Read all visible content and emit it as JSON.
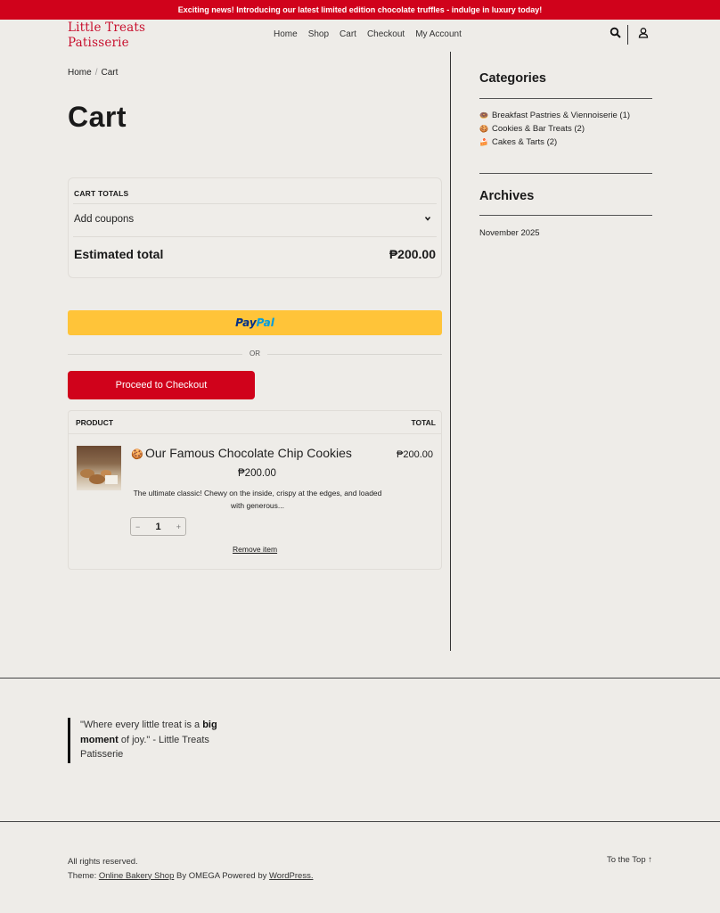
{
  "announcement": "Exciting news! Introducing our latest limited edition chocolate truffles - indulge in luxury today!",
  "brand": {
    "line1": "Little Treats",
    "line2": "Patisserie",
    "color": "#c8102e"
  },
  "nav": [
    "Home",
    "Shop",
    "Cart",
    "Checkout",
    "My Account"
  ],
  "header_icons": [
    "search-icon",
    "user-icon"
  ],
  "breadcrumb": {
    "home": "Home",
    "separator": "/",
    "current": "Cart"
  },
  "page_title": "Cart",
  "cart_totals": {
    "heading": "CART TOTALS",
    "coupon_label": "Add coupons",
    "estimated_label": "Estimated total",
    "estimated_value": "₱200.00"
  },
  "paypal": {
    "part1": "Pay",
    "part2": "Pal",
    "bg": "#ffc439"
  },
  "or_text": "OR",
  "checkout_button": "Proceed to Checkout",
  "items_table": {
    "col_product": "PRODUCT",
    "col_total": "TOTAL",
    "items": [
      {
        "icon": "🍪",
        "name": "Our Famous Chocolate Chip Cookies",
        "price": "₱200.00",
        "description": "The ultimate classic! Chewy on the inside, crispy at the edges, and loaded with generous...",
        "quantity": "1",
        "minus": "−",
        "plus": "+",
        "remove_label": "Remove item",
        "line_total": "₱200.00"
      }
    ]
  },
  "sidebar": {
    "categories_heading": "Categories",
    "categories": [
      {
        "emoji": "🍩",
        "label": "Breakfast Pastries & Viennoiserie (1)"
      },
      {
        "emoji": "🍪",
        "label": "Cookies & Bar Treats (2)"
      },
      {
        "emoji": "🍰",
        "label": "Cakes & Tarts (2)"
      }
    ],
    "archives_heading": "Archives",
    "archives": [
      "November 2025"
    ]
  },
  "footer": {
    "quote_part1": "\"Where every little treat is a ",
    "quote_bold1": "big",
    "quote_bold2": "moment",
    "quote_part2": " of joy.\" - Little Treats Patisserie",
    "rights": "All rights reserved.",
    "theme_prefix": "Theme: ",
    "theme_link": "Online Bakery Shop",
    "theme_by": " By OMEGA Powered by ",
    "wp_link": "WordPress.",
    "to_top": "To the Top ↑"
  },
  "colors": {
    "accent": "#d0021b",
    "background": "#eeece8"
  }
}
